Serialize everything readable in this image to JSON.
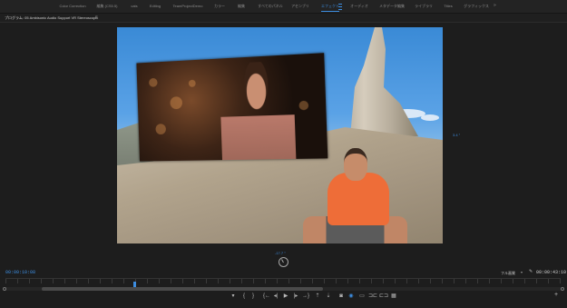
{
  "workspace_tabs": [
    {
      "label": "Color Correction",
      "active": false
    },
    {
      "label": "編集 (CS5.5)",
      "active": false
    },
    {
      "label": "cats",
      "active": false
    },
    {
      "label": "Editing",
      "active": false
    },
    {
      "label": "TeamProjectDemo",
      "active": false
    },
    {
      "label": "カラー",
      "active": false
    },
    {
      "label": "編集",
      "active": false
    },
    {
      "label": "すべてのパネル",
      "active": false
    },
    {
      "label": "アセンブリ",
      "active": false
    },
    {
      "label": "エフェクト",
      "active": true
    },
    {
      "label": "オーディオ",
      "active": false
    },
    {
      "label": "メタデータ編集",
      "active": false
    },
    {
      "label": "ライブラリ",
      "active": false
    },
    {
      "label": "Titles",
      "active": false
    },
    {
      "label": "グラフィックス",
      "active": false
    }
  ],
  "workspace_more": "»",
  "panel": {
    "title": "プログラム: 05 Ambisonic Audio Support VR Stereoscopic",
    "menu_icon": "≡"
  },
  "monitor": {
    "side_marker_right": "3.4 °",
    "side_marker_bottom": "-17.7 °"
  },
  "timecode": {
    "current": "00:00:10:08",
    "duration": "00:00:43:10",
    "fit_label": "フル画質",
    "fit_arrow": "▾"
  },
  "playback": {
    "progress_fraction": 0.23
  },
  "transport_buttons": [
    {
      "name": "marker-button",
      "glyph": "▾"
    },
    {
      "name": "in-point-button",
      "glyph": "{"
    },
    {
      "name": "out-point-button",
      "glyph": "}"
    },
    {
      "name": "go-to-in-button",
      "glyph": "{←"
    },
    {
      "name": "step-back-button",
      "glyph": "◂|"
    },
    {
      "name": "play-button",
      "glyph": "▶"
    },
    {
      "name": "step-forward-button",
      "glyph": "|▸"
    },
    {
      "name": "go-to-out-button",
      "glyph": "→}"
    },
    {
      "name": "lift-button",
      "glyph": "⇡"
    },
    {
      "name": "extract-button",
      "glyph": "⇣"
    },
    {
      "name": "export-frame-button",
      "glyph": "◙"
    },
    {
      "name": "vr-button",
      "glyph": "◉"
    },
    {
      "name": "safe-margins-button",
      "glyph": "▭"
    },
    {
      "name": "toggle-proxy-button",
      "glyph": "⊐⊏"
    },
    {
      "name": "comparison-view-button",
      "glyph": "⊏⊐"
    },
    {
      "name": "multicam-button",
      "glyph": "▦"
    }
  ],
  "add_button": "+",
  "colors": {
    "accent": "#3d8de0",
    "background": "#1d1d1d"
  }
}
